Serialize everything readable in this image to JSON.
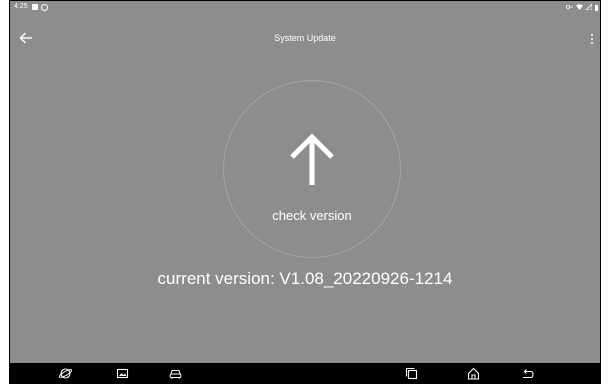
{
  "status_bar": {
    "time": "4:25"
  },
  "app_bar": {
    "title": "System Update"
  },
  "update_panel": {
    "check_label": "check version",
    "current_version": "current version: V1.08_20220926-1214"
  },
  "colors": {
    "background": "#8d8d8d",
    "nav_bar": "#000000",
    "text": "#ffffff"
  },
  "nav_bar": {
    "icons": [
      "browser-icon",
      "gallery-icon",
      "car-icon",
      "recent-apps-icon",
      "home-icon",
      "back-icon"
    ]
  }
}
